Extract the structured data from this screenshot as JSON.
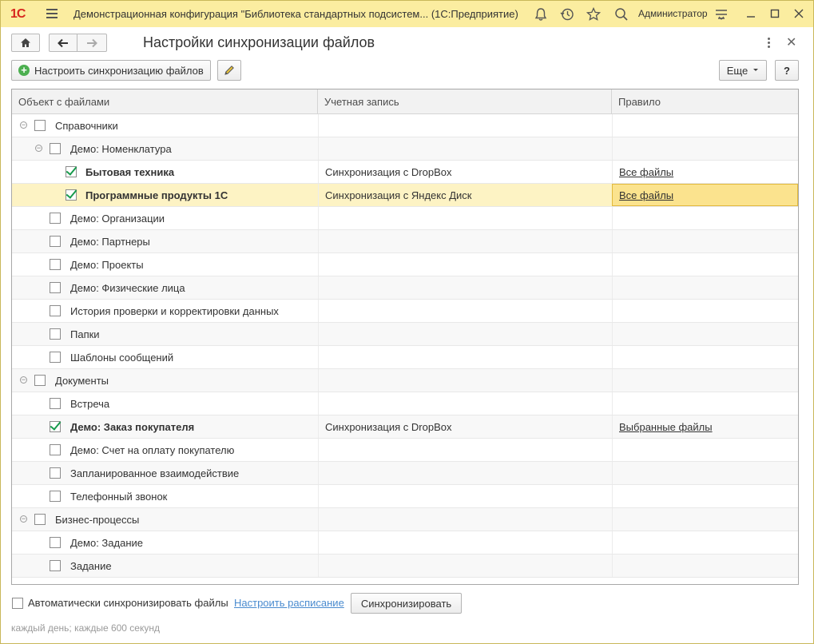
{
  "titlebar": {
    "logo": "1С",
    "app_title": "Демонстрационная конфигурация \"Библиотека стандартных подсистем...  (1С:Предприятие)",
    "user": "Администратор",
    "icons": [
      "bell-icon",
      "history-icon",
      "star-icon",
      "search-icon",
      "settings-icon"
    ]
  },
  "form": {
    "title": "Настройки синхронизации файлов"
  },
  "commands": {
    "setup_sync_label": "Настроить синхронизацию файлов",
    "more_label": "Еще",
    "help_label": "?"
  },
  "table": {
    "headers": [
      "Объект с файлами",
      "Учетная запись",
      "Правило"
    ],
    "rows": [
      {
        "level": 0,
        "group": true,
        "checked": false,
        "bold": false,
        "name": "Справочники",
        "account": "",
        "rule": ""
      },
      {
        "level": 1,
        "group": true,
        "checked": false,
        "bold": false,
        "name": "Демо: Номенклатура",
        "account": "",
        "rule": ""
      },
      {
        "level": 2,
        "group": false,
        "checked": true,
        "bold": true,
        "name": "Бытовая техника",
        "account": "Синхронизация с DropBox",
        "rule": "Все файлы"
      },
      {
        "level": 2,
        "group": false,
        "checked": true,
        "bold": true,
        "name": "Программные продукты 1С",
        "account": "Синхронизация с Яндекс Диск",
        "rule": "Все файлы",
        "selected": true
      },
      {
        "level": 1,
        "group": false,
        "checked": false,
        "bold": false,
        "name": "Демо: Организации",
        "account": "",
        "rule": ""
      },
      {
        "level": 1,
        "group": false,
        "checked": false,
        "bold": false,
        "name": "Демо: Партнеры",
        "account": "",
        "rule": ""
      },
      {
        "level": 1,
        "group": false,
        "checked": false,
        "bold": false,
        "name": "Демо: Проекты",
        "account": "",
        "rule": ""
      },
      {
        "level": 1,
        "group": false,
        "checked": false,
        "bold": false,
        "name": "Демо: Физические лица",
        "account": "",
        "rule": ""
      },
      {
        "level": 1,
        "group": false,
        "checked": false,
        "bold": false,
        "name": "История проверки и корректировки данных",
        "account": "",
        "rule": ""
      },
      {
        "level": 1,
        "group": false,
        "checked": false,
        "bold": false,
        "name": "Папки",
        "account": "",
        "rule": ""
      },
      {
        "level": 1,
        "group": false,
        "checked": false,
        "bold": false,
        "name": "Шаблоны сообщений",
        "account": "",
        "rule": ""
      },
      {
        "level": 0,
        "group": true,
        "checked": false,
        "bold": false,
        "name": "Документы",
        "account": "",
        "rule": ""
      },
      {
        "level": 1,
        "group": false,
        "checked": false,
        "bold": false,
        "name": "Встреча",
        "account": "",
        "rule": ""
      },
      {
        "level": 1,
        "group": false,
        "checked": true,
        "bold": true,
        "name": "Демо: Заказ покупателя",
        "account": "Синхронизация с DropBox",
        "rule": "Выбранные файлы"
      },
      {
        "level": 1,
        "group": false,
        "checked": false,
        "bold": false,
        "name": "Демо: Счет на оплату покупателю",
        "account": "",
        "rule": ""
      },
      {
        "level": 1,
        "group": false,
        "checked": false,
        "bold": false,
        "name": "Запланированное взаимодействие",
        "account": "",
        "rule": ""
      },
      {
        "level": 1,
        "group": false,
        "checked": false,
        "bold": false,
        "name": "Телефонный звонок",
        "account": "",
        "rule": ""
      },
      {
        "level": 0,
        "group": true,
        "checked": false,
        "bold": false,
        "name": "Бизнес-процессы",
        "account": "",
        "rule": ""
      },
      {
        "level": 1,
        "group": false,
        "checked": false,
        "bold": false,
        "name": "Демо: Задание",
        "account": "",
        "rule": ""
      },
      {
        "level": 1,
        "group": false,
        "checked": false,
        "bold": false,
        "name": "Задание",
        "account": "",
        "rule": ""
      }
    ]
  },
  "footer": {
    "auto_sync_label": "Автоматически синхронизировать файлы",
    "auto_sync_checked": false,
    "schedule_link": "Настроить расписание",
    "sync_button": "Синхронизировать",
    "schedule_text": "каждый день; каждые 600 секунд"
  },
  "colors": {
    "titlebar_bg": "#fbeda0",
    "selected_row_bg": "#fdf3c4",
    "checkmark": "#179a4c",
    "link_blue": "#4a8bcf",
    "logo_red": "#d7261e"
  }
}
